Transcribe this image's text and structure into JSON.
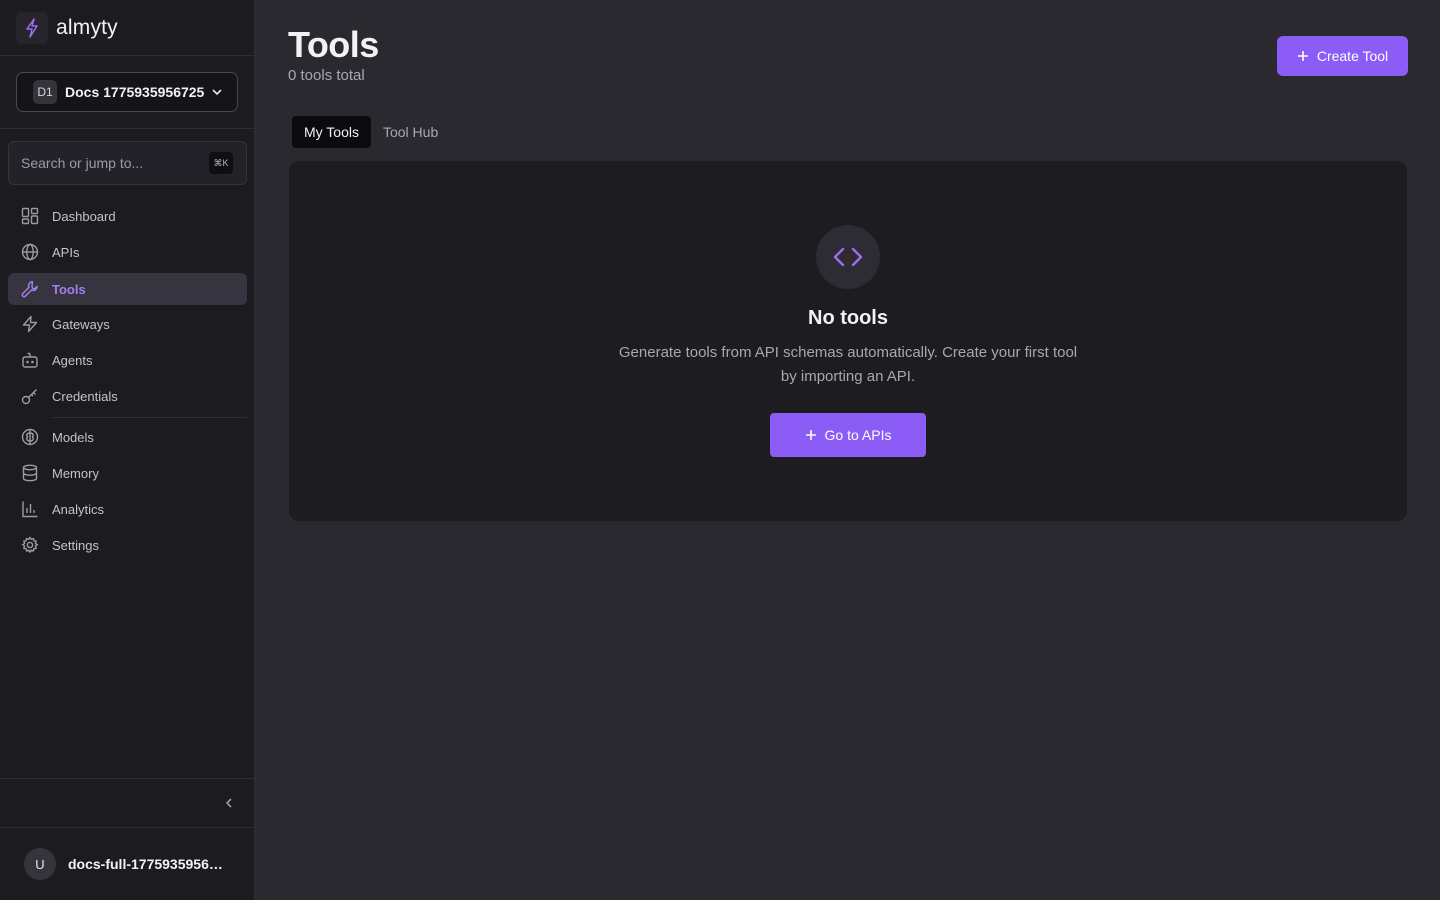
{
  "brand": {
    "name": "almyty",
    "icon": "bolt-icon"
  },
  "workspace": {
    "badge": "D1",
    "name": "Docs 1775935956725",
    "icon": "chevron-down-icon"
  },
  "search": {
    "placeholder": "Search or jump to...",
    "shortcut": "⌘K"
  },
  "sidebar": {
    "items": [
      {
        "label": "Dashboard",
        "icon": "grid-icon",
        "active": false
      },
      {
        "label": "APIs",
        "icon": "globe-icon",
        "active": false
      },
      {
        "label": "Tools",
        "icon": "wrench-icon",
        "active": true
      },
      {
        "label": "Gateways",
        "icon": "bolt-icon",
        "active": false
      },
      {
        "label": "Agents",
        "icon": "bot-icon",
        "active": false
      },
      {
        "label": "Credentials",
        "icon": "key-icon",
        "active": false
      },
      {
        "label": "Models",
        "icon": "brain-icon",
        "active": false
      },
      {
        "label": "Memory",
        "icon": "database-icon",
        "active": false
      },
      {
        "label": "Analytics",
        "icon": "bar-chart-icon",
        "active": false
      },
      {
        "label": "Settings",
        "icon": "gear-icon",
        "active": false
      }
    ]
  },
  "user": {
    "initial": "U",
    "name": "docs-full-1775935956…"
  },
  "page": {
    "title": "Tools",
    "subtitle": "0 tools total",
    "create_button": "Create Tool"
  },
  "tabs": [
    {
      "label": "My Tools",
      "active": true
    },
    {
      "label": "Tool Hub",
      "active": false
    }
  ],
  "empty_state": {
    "icon": "code-icon",
    "title": "No tools",
    "description": "Generate tools from API schemas automatically. Create your first tool by importing an API.",
    "button": "Go to APIs"
  },
  "colors": {
    "accent": "#8b5cf6",
    "active_nav_text": "#a57cf0",
    "sidebar_bg": "#1c1b20",
    "main_bg": "#2a292f"
  }
}
